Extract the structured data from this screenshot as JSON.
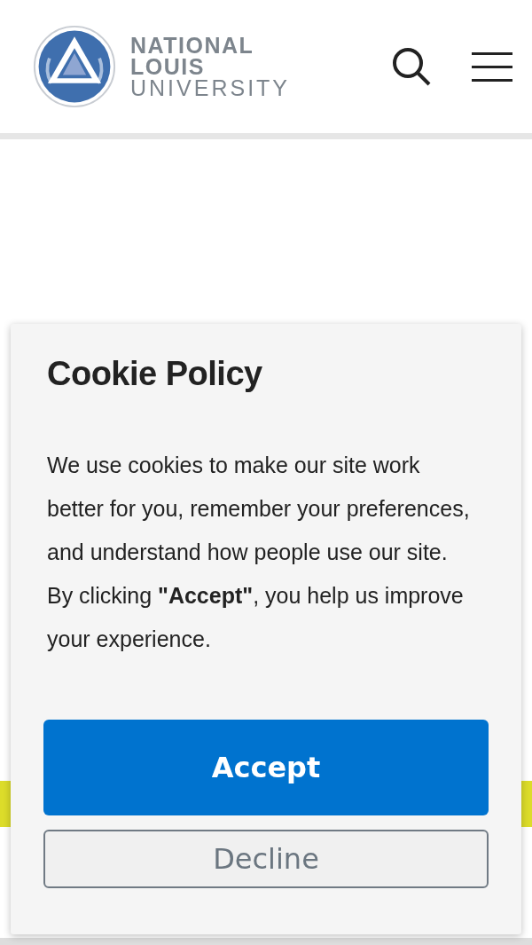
{
  "header": {
    "logo_lines": [
      "NATIONAL",
      "LOUIS",
      "UNIVERSITY"
    ]
  },
  "cookie_dialog": {
    "title": "Cookie Policy",
    "message": "We use cookies to make our site work better for you, remember your preferences, and understand how people use our site. By clicking **\"Accept\"**, you help us improve your experience.",
    "buttons": [
      {
        "label": "Accept",
        "kind": "primary"
      },
      {
        "label": "Decline",
        "kind": "secondary"
      }
    ]
  }
}
